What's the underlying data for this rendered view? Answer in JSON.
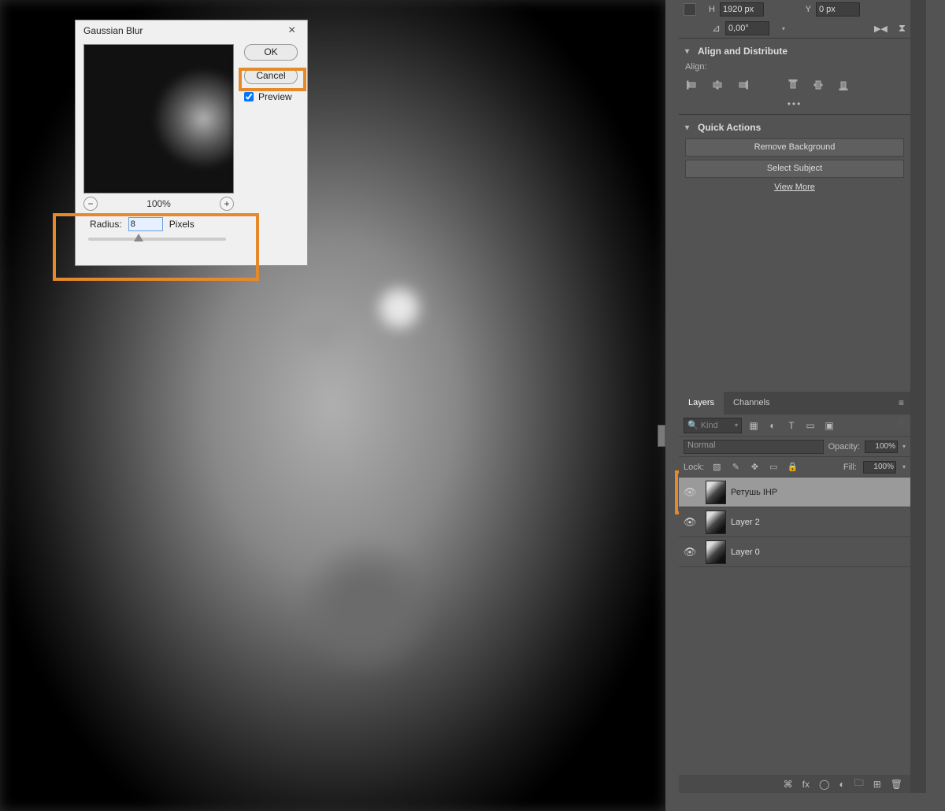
{
  "dialog": {
    "title": "Gaussian Blur",
    "ok": "OK",
    "cancel": "Cancel",
    "preview": "Preview",
    "zoom": "100%",
    "radius_label": "Radius:",
    "radius_value": "8",
    "radius_unit": "Pixels"
  },
  "transform": {
    "h_label": "H",
    "h_value": "1920 px",
    "y_label": "Y",
    "y_value": "0 px",
    "angle": "0,00°"
  },
  "sections": {
    "align_title": "Align and Distribute",
    "align_label": "Align:",
    "quick_title": "Quick Actions",
    "remove_bg": "Remove Background",
    "select_subject": "Select Subject",
    "view_more": "View More"
  },
  "tabs": {
    "layers": "Layers",
    "channels": "Channels"
  },
  "layers_panel": {
    "kind": "Kind",
    "blend": "Normal",
    "opacity_label": "Opacity:",
    "opacity_value": "100%",
    "lock_label": "Lock:",
    "fill_label": "Fill:",
    "fill_value": "100%"
  },
  "layers": [
    {
      "name": "Ретушь IHP",
      "selected": true
    },
    {
      "name": "Layer 2",
      "selected": false
    },
    {
      "name": "Layer 0",
      "selected": false
    }
  ]
}
